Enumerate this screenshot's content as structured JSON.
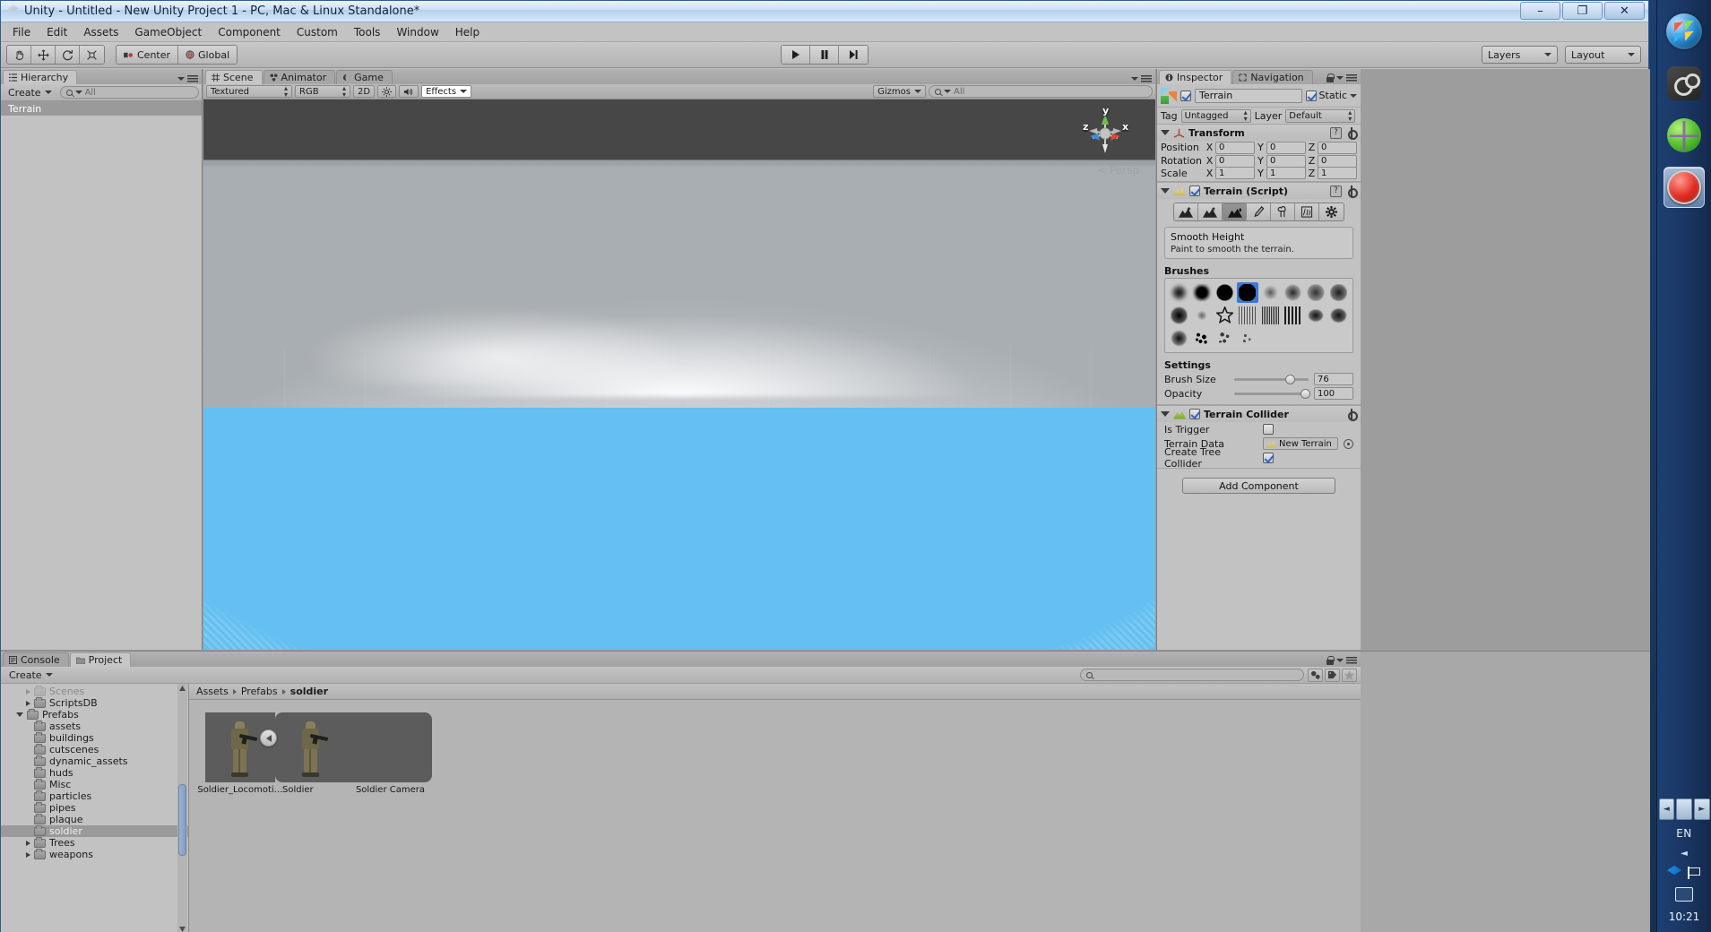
{
  "window": {
    "title": "Unity - Untitled - New Unity Project 1 - PC, Mac & Linux Standalone*",
    "minimize": "–",
    "maximize": "❐",
    "close": "✕"
  },
  "menubar": {
    "items": [
      "File",
      "Edit",
      "Assets",
      "GameObject",
      "Component",
      "Custom",
      "Tools",
      "Window",
      "Help"
    ]
  },
  "toolbar": {
    "transform_tools": [
      "hand-tool",
      "move-tool",
      "rotate-tool",
      "scale-tool"
    ],
    "pivot_mode": "Center",
    "pivot_rotation": "Global",
    "play": "play-button",
    "pause": "pause-button",
    "step": "step-button",
    "layers_label": "Layers",
    "layout_label": "Layout"
  },
  "hierarchy": {
    "tab": "Hierarchy",
    "create_label": "Create",
    "search_value": "All",
    "items": [
      {
        "label": "Terrain",
        "selected": true
      }
    ]
  },
  "scene": {
    "tabs": [
      {
        "label": "Scene",
        "active": true
      },
      {
        "label": "Animator",
        "active": false
      },
      {
        "label": "Game",
        "active": false
      }
    ],
    "draw_mode": "Textured",
    "color_mode": "RGB",
    "two_d": "2D",
    "lighting": "light-toggle",
    "audio": "audio-toggle",
    "effects": "Effects",
    "gizmos": "Gizmos",
    "search_value": "All",
    "gizmo_axes": {
      "x": "x",
      "y": "y",
      "z": "z"
    },
    "projection": "Persp"
  },
  "inspector": {
    "tabs": [
      {
        "label": "Inspector",
        "active": true
      },
      {
        "label": "Navigation",
        "active": false
      }
    ],
    "object_name": "Terrain",
    "object_enabled": true,
    "static_label": "Static",
    "static_checked": true,
    "tag_label": "Tag",
    "tag_value": "Untagged",
    "layer_label": "Layer",
    "layer_value": "Default",
    "transform": {
      "title": "Transform",
      "rows": [
        {
          "label": "Position",
          "x": "0",
          "y": "0",
          "z": "0"
        },
        {
          "label": "Rotation",
          "x": "0",
          "y": "0",
          "z": "0"
        },
        {
          "label": "Scale",
          "x": "1",
          "y": "1",
          "z": "1"
        }
      ]
    },
    "terrain_script": {
      "title": "Terrain (Script)",
      "enabled": true,
      "tools": [
        "raise-lower-terrain-tool",
        "paint-height-tool",
        "smooth-height-tool",
        "paint-texture-tool",
        "place-trees-tool",
        "paint-details-tool",
        "terrain-settings-tool"
      ],
      "selected_tool_index": 2,
      "tool_title": "Smooth Height",
      "tool_description": "Paint to smooth the terrain.",
      "brushes_label": "Brushes",
      "brush_count": 20,
      "selected_brush_index": 3,
      "settings_label": "Settings",
      "brush_size_label": "Brush Size",
      "brush_size_value": "76",
      "brush_size_percent": 76,
      "opacity_label": "Opacity",
      "opacity_value": "100",
      "opacity_percent": 100
    },
    "terrain_collider": {
      "title": "Terrain Collider",
      "enabled": true,
      "is_trigger_label": "Is Trigger",
      "is_trigger_checked": false,
      "terrain_data_label": "Terrain Data",
      "terrain_data_value": "New Terrain",
      "create_tree_collider_label": "Create Tree Collider",
      "create_tree_collider_checked": true
    },
    "add_component": "Add Component"
  },
  "project": {
    "tabs": [
      {
        "label": "Console",
        "active": false
      },
      {
        "label": "Project",
        "active": true
      }
    ],
    "create_label": "Create",
    "search_value": "",
    "tree": [
      {
        "label": "Scenes",
        "depth": 2,
        "arrow": "closed",
        "selected": false,
        "clipped": true
      },
      {
        "label": "ScriptsDB",
        "depth": 2,
        "arrow": "closed",
        "selected": false
      },
      {
        "label": "Prefabs",
        "depth": 1,
        "arrow": "open",
        "selected": false
      },
      {
        "label": "assets",
        "depth": 2,
        "arrow": "none",
        "selected": false
      },
      {
        "label": "buildings",
        "depth": 2,
        "arrow": "none",
        "selected": false
      },
      {
        "label": "cutscenes",
        "depth": 2,
        "arrow": "none",
        "selected": false
      },
      {
        "label": "dynamic_assets",
        "depth": 2,
        "arrow": "none",
        "selected": false
      },
      {
        "label": "huds",
        "depth": 2,
        "arrow": "none",
        "selected": false
      },
      {
        "label": "Misc",
        "depth": 2,
        "arrow": "none",
        "selected": false
      },
      {
        "label": "particles",
        "depth": 2,
        "arrow": "none",
        "selected": false
      },
      {
        "label": "pipes",
        "depth": 2,
        "arrow": "none",
        "selected": false
      },
      {
        "label": "plaque",
        "depth": 2,
        "arrow": "none",
        "selected": false
      },
      {
        "label": "soldier",
        "depth": 2,
        "arrow": "none",
        "selected": true
      },
      {
        "label": "Trees",
        "depth": 2,
        "arrow": "closed",
        "selected": false
      },
      {
        "label": "weapons",
        "depth": 2,
        "arrow": "closed",
        "selected": false
      }
    ],
    "breadcrumb": [
      "Assets",
      "Prefabs",
      "soldier"
    ],
    "assets": [
      {
        "label": "Soldier_Locomoti…",
        "kind": "prefab-thumbnail"
      },
      {
        "label": "Soldier",
        "kind": "prefab-thumbnail"
      },
      {
        "label": "Soldier Camera",
        "kind": "prefab-thumbnail"
      }
    ]
  },
  "taskbar": {
    "icons": [
      "windows-orb-icon",
      "steam-icon",
      "globe-icon",
      "record-icon"
    ],
    "active_icon_index": 3,
    "language": "EN",
    "tray_icons": [
      "dropbox-icon",
      "flag-icon",
      "monitor-icon"
    ],
    "clock": "10:21"
  },
  "colors": {
    "accent": "#3b78d8",
    "panel": "#c2c2c2",
    "water": "#63c0f0",
    "selection": "#9a9a9a"
  }
}
